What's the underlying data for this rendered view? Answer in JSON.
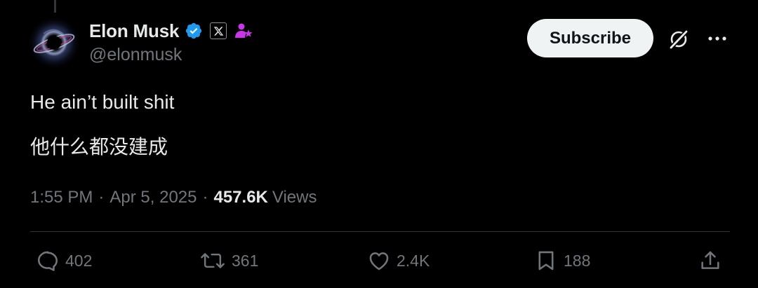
{
  "author": {
    "display_name": "Elon Musk",
    "handle": "@elonmusk",
    "verified_color": "#1d9bf0",
    "affiliate_badge": "x-logo",
    "subscriber_badge_color": "#c936e6"
  },
  "header": {
    "subscribe_label": "Subscribe",
    "grok_icon": "grok-icon",
    "more_icon": "more-icon"
  },
  "tweet": {
    "text_line1": "He ain’t built shit",
    "text_line2": "他什么都没建成"
  },
  "meta": {
    "time": "1:55 PM",
    "separator": "·",
    "date": "Apr 5, 2025",
    "views_count": "457.6K",
    "views_label": "Views"
  },
  "actions": {
    "reply_count": "402",
    "repost_count": "361",
    "like_count": "2.4K",
    "bookmark_count": "188"
  },
  "colors": {
    "background": "#000000",
    "text_primary": "#e7e9ea",
    "text_secondary": "#71767b",
    "divider": "#2f3336",
    "button_bg": "#eff3f4"
  }
}
